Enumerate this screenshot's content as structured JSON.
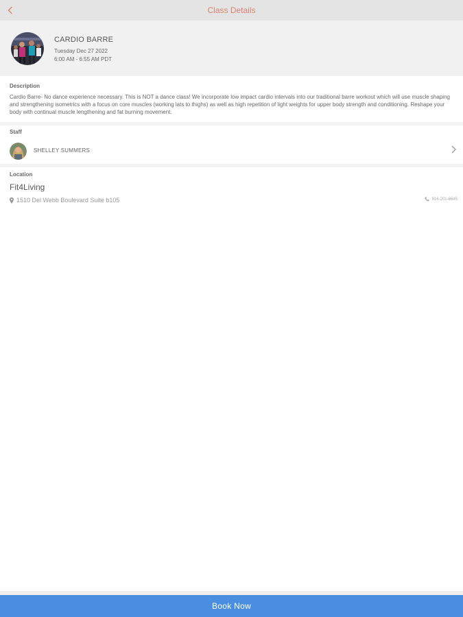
{
  "nav": {
    "title": "Class Details",
    "back_icon": "chevron-left-icon"
  },
  "class_info": {
    "name": "CARDIO BARRE",
    "date": "Tuesday Dec 27 2022",
    "time": "6:00 AM - 6:55 AM PDT"
  },
  "description": {
    "label": "Description",
    "text": "Cardio Barre- No dance experience necessary. This is NOT a dance class! We incorporate low impact cardio intervals into our traditional barre workout which will use muscle shaping and strengthening isometrics with a focus on core muscles (working lats to thighs) as well as high repetition of light weights for upper body strength and conditioning. Reshape your body with continual muscle lengthening and fat burning movement."
  },
  "staff": {
    "label": "Staff",
    "name": "SHELLEY SUMMERS"
  },
  "location": {
    "label": "Location",
    "name": "Fit4Living",
    "address": "1510 Del Webb Boulevard Suite b105",
    "phone": "916-201-8645"
  },
  "actions": {
    "book_label": "Book Now"
  },
  "colors": {
    "accent": "#d9826f",
    "button": "#4a8fdf",
    "header_bg": "#e4e4e4"
  }
}
